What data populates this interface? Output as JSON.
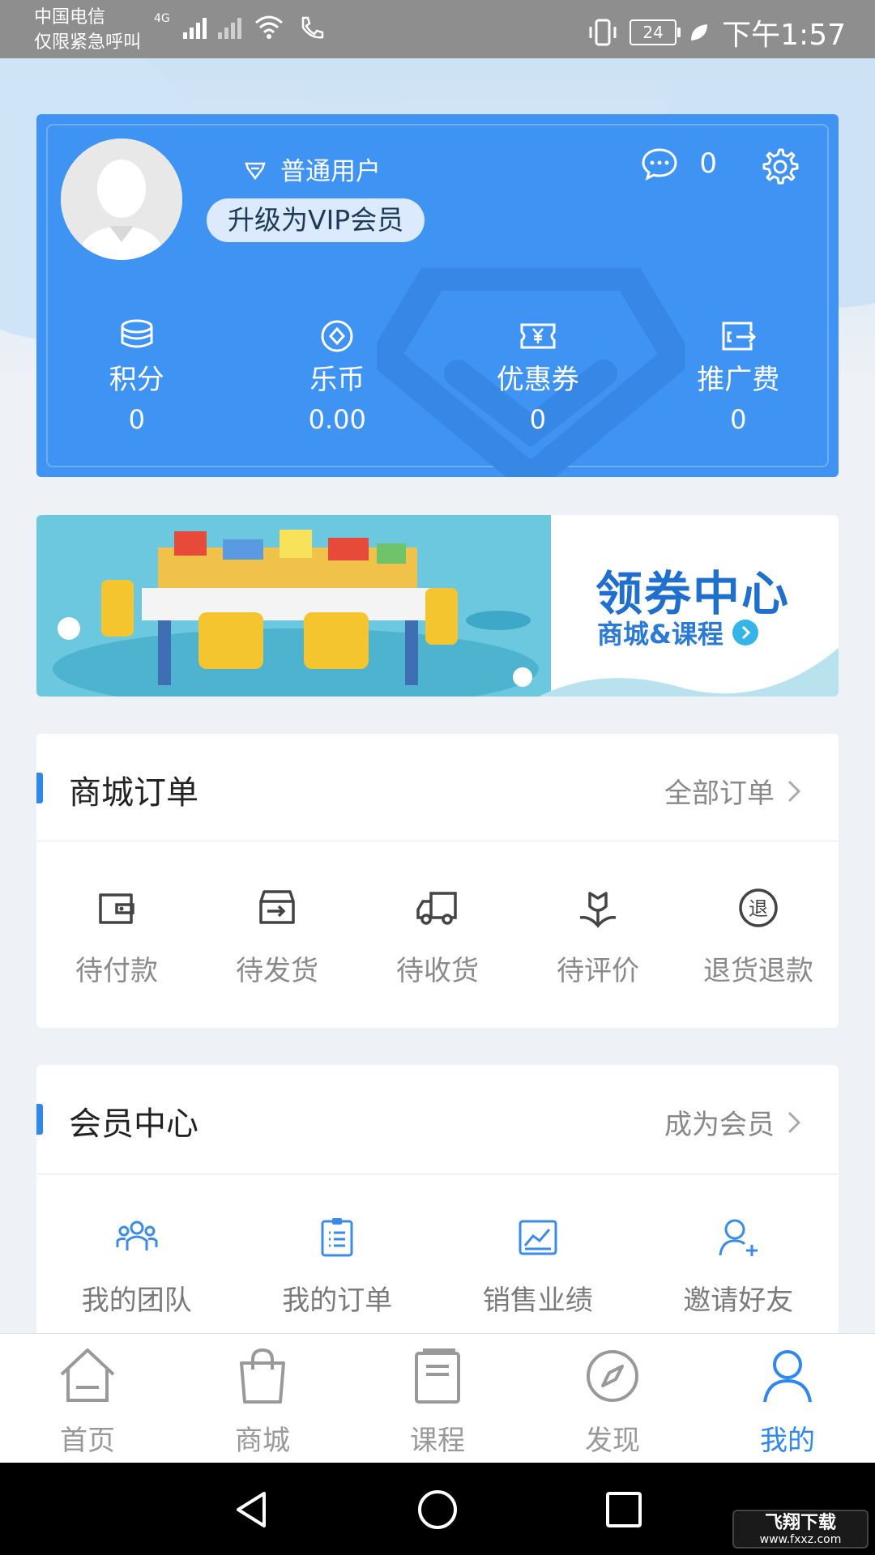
{
  "status_bar": {
    "carrier_line1": "中国电信",
    "carrier_line2": "仅限紧急呼叫",
    "network_label": "4G",
    "battery": "24",
    "time": "下午1:57"
  },
  "user_card": {
    "level": "普通用户",
    "vip_button": "升级为VIP会员",
    "message_count": "0",
    "stats": [
      {
        "label": "积分",
        "value": "0",
        "icon": "coins-icon"
      },
      {
        "label": "乐币",
        "value": "0.00",
        "icon": "coin-icon"
      },
      {
        "label": "优惠券",
        "value": "0",
        "icon": "coupon-icon"
      },
      {
        "label": "推广费",
        "value": "0",
        "icon": "promotion-fee-icon"
      }
    ]
  },
  "banner": {
    "title": "领券中心",
    "subtitle": "商城&课程"
  },
  "orders": {
    "title": "商城订单",
    "link": "全部订单",
    "items": [
      {
        "label": "待付款",
        "icon": "wallet-icon"
      },
      {
        "label": "待发货",
        "icon": "shipping-box-icon"
      },
      {
        "label": "待收货",
        "icon": "truck-icon"
      },
      {
        "label": "待评价",
        "icon": "flower-icon"
      },
      {
        "label": "退货退款",
        "icon": "refund-icon"
      }
    ]
  },
  "member": {
    "title": "会员中心",
    "link": "成为会员",
    "items": [
      {
        "label": "我的团队",
        "icon": "team-icon"
      },
      {
        "label": "我的订单",
        "icon": "clipboard-icon"
      },
      {
        "label": "销售业绩",
        "icon": "chart-icon"
      },
      {
        "label": "邀请好友",
        "icon": "add-user-icon"
      }
    ]
  },
  "bottom_nav": [
    {
      "label": "首页",
      "icon": "home-icon"
    },
    {
      "label": "商城",
      "icon": "shopping-bag-icon"
    },
    {
      "label": "课程",
      "icon": "book-icon"
    },
    {
      "label": "发现",
      "icon": "compass-icon"
    },
    {
      "label": "我的",
      "icon": "user-icon",
      "active": true
    }
  ],
  "watermark": {
    "text": "飞翔下载",
    "url_text": "www.fxxz.com"
  },
  "colors": {
    "primary": "#3e93f3",
    "accent": "#2f88f0",
    "banner_title": "#1f6fcf"
  }
}
